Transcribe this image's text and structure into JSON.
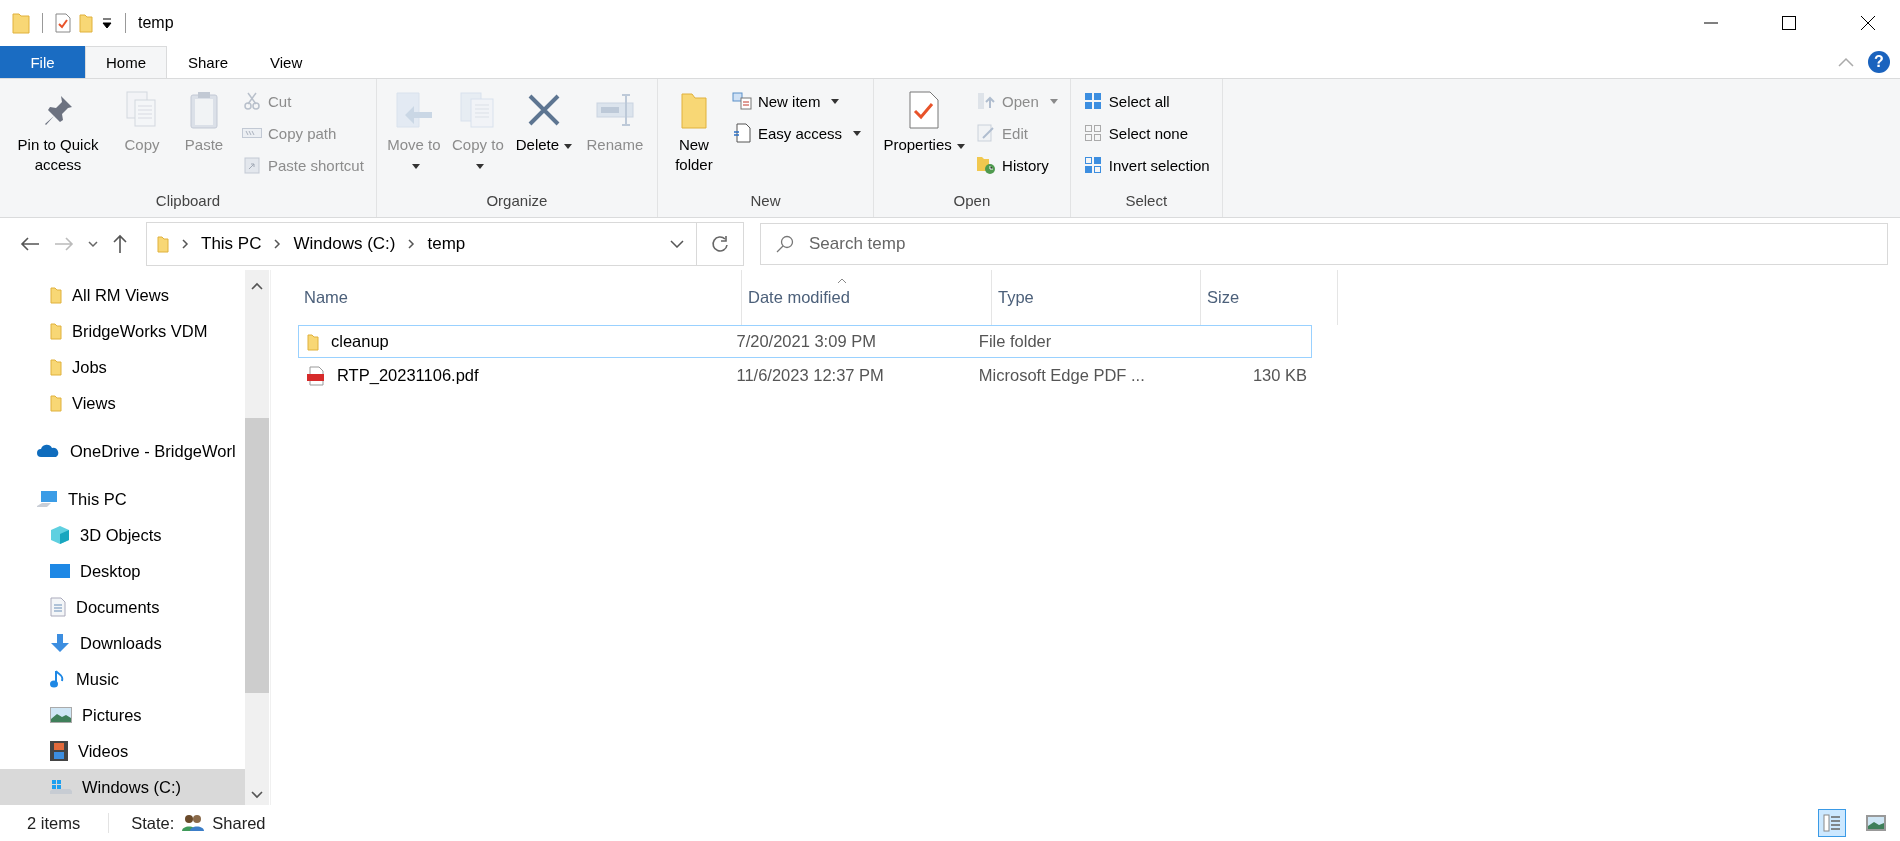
{
  "window": {
    "title": "temp"
  },
  "ribbon_tabs": {
    "file_tab": "File",
    "tabs": [
      {
        "label": "Home",
        "selected": true
      },
      {
        "label": "Share",
        "selected": false
      },
      {
        "label": "View",
        "selected": false
      }
    ]
  },
  "help": "?",
  "ribbon": {
    "groups": [
      {
        "label": "Clipboard",
        "items": [
          {
            "kind": "large",
            "label": "Pin to Quick access",
            "disabled": false,
            "has_menu": false
          },
          {
            "kind": "large",
            "label": "Copy",
            "disabled": true,
            "has_menu": false
          },
          {
            "kind": "large",
            "label": "Paste",
            "disabled": true,
            "has_menu": false
          },
          {
            "kind": "small",
            "label": "Cut",
            "disabled": true,
            "has_menu": false
          },
          {
            "kind": "small",
            "label": "Copy path",
            "disabled": true,
            "has_menu": false
          },
          {
            "kind": "small",
            "label": "Paste shortcut",
            "disabled": true,
            "has_menu": false
          }
        ]
      },
      {
        "label": "Organize",
        "items": [
          {
            "kind": "large",
            "label": "Move to",
            "disabled": true,
            "has_menu": true
          },
          {
            "kind": "large",
            "label": "Copy to",
            "disabled": true,
            "has_menu": true
          },
          {
            "kind": "large",
            "label": "Delete",
            "disabled": false,
            "has_menu": true
          },
          {
            "kind": "large",
            "label": "Rename",
            "disabled": true,
            "has_menu": false
          }
        ]
      },
      {
        "label": "New",
        "items": [
          {
            "kind": "large",
            "label": "New folder",
            "disabled": false,
            "has_menu": false
          },
          {
            "kind": "small",
            "label": "New item",
            "disabled": false,
            "has_menu": true
          },
          {
            "kind": "small",
            "label": "Easy access",
            "disabled": false,
            "has_menu": true
          }
        ]
      },
      {
        "label": "Open",
        "items": [
          {
            "kind": "large",
            "label": "Properties",
            "disabled": false,
            "has_menu": true
          },
          {
            "kind": "small",
            "label": "Open",
            "disabled": true,
            "has_menu": true
          },
          {
            "kind": "small",
            "label": "Edit",
            "disabled": true,
            "has_menu": false
          },
          {
            "kind": "small",
            "label": "History",
            "disabled": false,
            "has_menu": false
          }
        ]
      },
      {
        "label": "Select",
        "items": [
          {
            "kind": "small",
            "label": "Select all",
            "disabled": false,
            "has_menu": false
          },
          {
            "kind": "small",
            "label": "Select none",
            "disabled": false,
            "has_menu": false
          },
          {
            "kind": "small",
            "label": "Invert selection",
            "disabled": false,
            "has_menu": false
          }
        ]
      }
    ]
  },
  "address_bar": {
    "crumbs": [
      "This PC",
      "Windows (C:)",
      "temp"
    ]
  },
  "search": {
    "placeholder": "Search temp"
  },
  "nav_pane": {
    "quick_access_items": [
      {
        "label": "All RM Views",
        "selected": false
      },
      {
        "label": "BridgeWorks VDM",
        "selected": false
      },
      {
        "label": "Jobs",
        "selected": false
      },
      {
        "label": "Views",
        "selected": false
      }
    ],
    "tree": [
      {
        "label": "OneDrive - BridgeWorl",
        "selected": false
      },
      {
        "label": "This PC",
        "selected": false,
        "children": [
          {
            "label": "3D Objects",
            "selected": false
          },
          {
            "label": "Desktop",
            "selected": false
          },
          {
            "label": "Documents",
            "selected": false
          },
          {
            "label": "Downloads",
            "selected": false
          },
          {
            "label": "Music",
            "selected": false
          },
          {
            "label": "Pictures",
            "selected": false
          },
          {
            "label": "Videos",
            "selected": false
          },
          {
            "label": "Windows (C:)",
            "selected": true
          }
        ]
      }
    ]
  },
  "file_list": {
    "columns": [
      {
        "label": "Name",
        "sorted": false
      },
      {
        "label": "Date modified",
        "sorted": true
      },
      {
        "label": "Type",
        "sorted": false
      },
      {
        "label": "Size",
        "sorted": false
      }
    ],
    "rows": [
      {
        "kind": "folder",
        "name": "cleanup",
        "date_modified": "7/20/2021 3:09 PM",
        "type": "File folder",
        "focused": true
      },
      {
        "kind": "pdf",
        "name": "RTP_20231106.pdf",
        "date_modified": "11/6/2023 12:37 PM",
        "type": "Microsoft Edge PDF ...",
        "size": "130 KB",
        "focused": false
      }
    ]
  },
  "status_bar": {
    "item_count": "2 items",
    "state_label": "State:",
    "state_value": "Shared",
    "views": [
      {
        "kind": "details",
        "selected": true
      },
      {
        "kind": "large_icons",
        "selected": false
      }
    ]
  }
}
